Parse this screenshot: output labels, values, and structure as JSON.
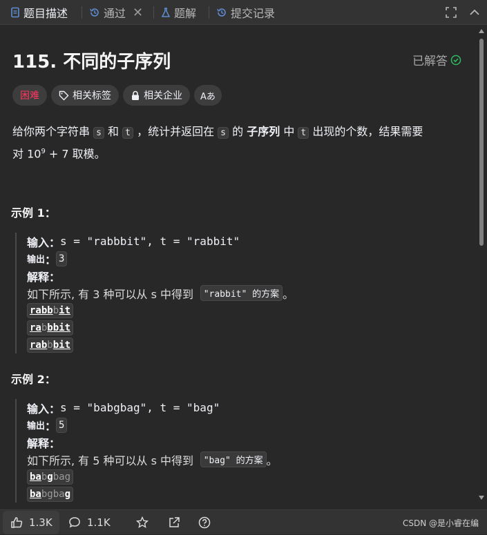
{
  "tabs": [
    {
      "label": "题目描述",
      "icon": "description-icon",
      "active": true
    },
    {
      "label": "通过",
      "icon": "history-icon",
      "active": false
    },
    {
      "label": "题解",
      "icon": "flask-icon",
      "active": false
    },
    {
      "label": "提交记录",
      "icon": "history-icon",
      "active": false
    }
  ],
  "problem": {
    "title": "115. 不同的子序列",
    "status": "已解答",
    "tags": [
      "困难",
      "相关标签",
      "相关企业",
      "Aあ"
    ],
    "desc": {
      "p1": "给你两个字符串",
      "s": "s",
      "p2": "和",
      "t": "t",
      "p3": "，统计并返回在",
      "p4": "的",
      "p5": "子序列",
      "p6": "中",
      "p7": "出现的个数，结果需要",
      "p8": "对 10",
      "exp": "9",
      "p9": " + 7 取模。"
    }
  },
  "examples": [
    {
      "title": "示例 1：",
      "input_label": "输入：",
      "input_value": "s = \"rabbbit\", t = \"rabbit\"",
      "output_label": "输出",
      "output_colon": "：",
      "output_value": "3",
      "explain_label": "解释：",
      "explain_text": "如下所示, 有 3 种可以从 s 中得到",
      "explain_code": "\"rabbit\" 的方案",
      "explain_end": "。",
      "sequences": [
        [
          {
            "t": "rabb",
            "b": true
          },
          {
            "t": "b",
            "b": false
          },
          {
            "t": "it",
            "b": true
          }
        ],
        [
          {
            "t": "ra",
            "b": true
          },
          {
            "t": "b",
            "b": false
          },
          {
            "t": "bbit",
            "b": true
          }
        ],
        [
          {
            "t": "rab",
            "b": true
          },
          {
            "t": "b",
            "b": false
          },
          {
            "t": "bit",
            "b": true
          }
        ]
      ]
    },
    {
      "title": "示例 2：",
      "input_label": "输入：",
      "input_value": "s = \"babgbag\", t = \"bag\"",
      "output_label": "输出",
      "output_colon": "：",
      "output_value": "5",
      "explain_label": "解释：",
      "explain_text": "如下所示, 有 5 种可以从 s 中得到",
      "explain_code": "\"bag\" 的方案",
      "explain_end": "。",
      "sequences": [
        [
          {
            "t": "ba",
            "b": true
          },
          {
            "t": "b",
            "b": false
          },
          {
            "t": "g",
            "b": true
          },
          {
            "t": "bag",
            "b": false
          }
        ],
        [
          {
            "t": "ba",
            "b": true
          },
          {
            "t": "bgba",
            "b": false
          },
          {
            "t": "g",
            "b": true
          }
        ]
      ]
    }
  ],
  "footer": {
    "likes": "1.3K",
    "comments": "1.1K",
    "watermark": "CSDN @是小睿在编"
  },
  "colors": {
    "background": "#282828",
    "bar": "#333333",
    "hard": "#ff375f",
    "solved_check": "#2cbb5d",
    "tab_icon_blue": "#5f8dd3"
  }
}
